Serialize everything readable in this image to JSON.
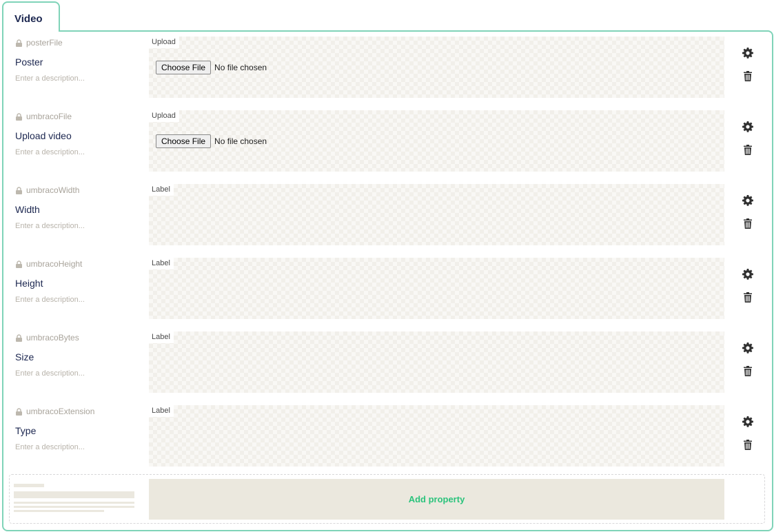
{
  "tab": {
    "label": "Video"
  },
  "properties": [
    {
      "alias": "posterFile",
      "name": "Poster",
      "description": "Enter a description...",
      "editor": "Upload",
      "file_button": "Choose File",
      "file_status": "No file chosen"
    },
    {
      "alias": "umbracoFile",
      "name": "Upload video",
      "description": "Enter a description...",
      "editor": "Upload",
      "file_button": "Choose File",
      "file_status": "No file chosen"
    },
    {
      "alias": "umbracoWidth",
      "name": "Width",
      "description": "Enter a description...",
      "editor": "Label"
    },
    {
      "alias": "umbracoHeight",
      "name": "Height",
      "description": "Enter a description...",
      "editor": "Label"
    },
    {
      "alias": "umbracoBytes",
      "name": "Size",
      "description": "Enter a description...",
      "editor": "Label"
    },
    {
      "alias": "umbracoExtension",
      "name": "Type",
      "description": "Enter a description...",
      "editor": "Label"
    }
  ],
  "add_property": {
    "label": "Add property"
  },
  "icons": {
    "lock": "lock-icon",
    "settings": "gear-icon",
    "delete": "trash-icon"
  },
  "colors": {
    "accent_border": "#7fd3b8",
    "add_text": "#2bc37c",
    "heading": "#1b264f"
  }
}
